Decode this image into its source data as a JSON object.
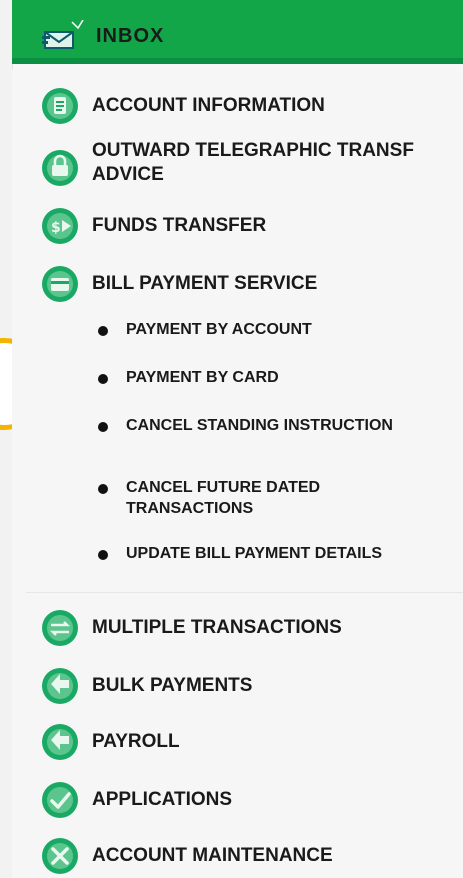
{
  "header": {
    "title": "INBOX",
    "icon": "envelope-icon",
    "bg_color": "#12a649"
  },
  "menu": {
    "items": [
      {
        "label": "ACCOUNT INFORMATION",
        "icon": "account-info-icon"
      },
      {
        "label_lines": [
          "OUTWARD TELEGRAPHIC TRANSF",
          "ADVICE"
        ],
        "icon": "telegraphic-transfer-icon"
      },
      {
        "label": "FUNDS TRANSFER",
        "icon": "funds-transfer-icon"
      },
      {
        "label": "BILL PAYMENT SERVICE",
        "icon": "bill-payment-icon"
      },
      {
        "label": "MULTIPLE TRANSACTIONS",
        "icon": "multiple-transactions-icon"
      },
      {
        "label": "BULK PAYMENTS",
        "icon": "bulk-payments-icon"
      },
      {
        "label": "PAYROLL",
        "icon": "payroll-icon"
      },
      {
        "label": "APPLICATIONS",
        "icon": "applications-icon"
      },
      {
        "label": "ACCOUNT MAINTENANCE",
        "icon": "account-maintenance-icon"
      }
    ],
    "bill_payment_subitems": [
      {
        "label": "PAYMENT BY ACCOUNT"
      },
      {
        "label": "PAYMENT BY CARD"
      },
      {
        "label": "CANCEL STANDING INSTRUCTION"
      },
      {
        "label_lines": [
          "CANCEL FUTURE DATED",
          "TRANSACTIONS"
        ]
      },
      {
        "label": "UPDATE BILL PAYMENT DETAILS"
      }
    ]
  },
  "colors": {
    "accent_green": "#12a649",
    "icon_green": "#15a15c",
    "pointer_yellow": "#f2b400"
  }
}
